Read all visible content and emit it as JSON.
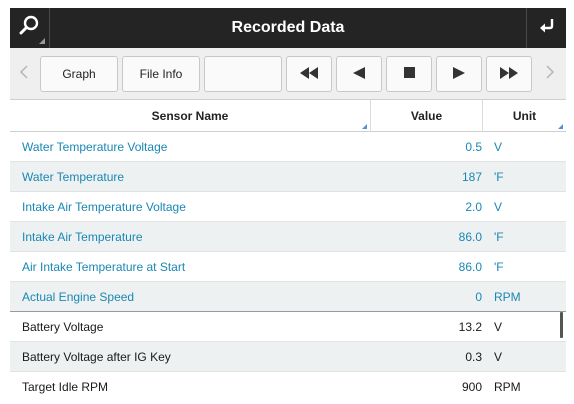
{
  "window": {
    "title": "Recorded Data"
  },
  "toolbar": {
    "graph_label": "Graph",
    "file_info_label": "File Info",
    "blank_label": ""
  },
  "table": {
    "headers": {
      "name": "Sensor Name",
      "value": "Value",
      "unit": "Unit"
    },
    "rows": [
      {
        "name": "Water Temperature Voltage",
        "value": "0.5",
        "unit": "V",
        "style": "blue"
      },
      {
        "name": "Water Temperature",
        "value": "187",
        "unit": "'F",
        "style": "blue"
      },
      {
        "name": "Intake Air Temperature Voltage",
        "value": "2.0",
        "unit": "V",
        "style": "blue"
      },
      {
        "name": "Intake Air Temperature",
        "value": "86.0",
        "unit": "'F",
        "style": "blue"
      },
      {
        "name": "Air Intake Temperature at Start",
        "value": "86.0",
        "unit": "'F",
        "style": "blue"
      },
      {
        "name": "Actual Engine Speed",
        "value": "0",
        "unit": "RPM",
        "style": "blue"
      },
      {
        "name": "Battery Voltage",
        "value": "13.2",
        "unit": "V",
        "style": "black"
      },
      {
        "name": "Battery Voltage after IG Key",
        "value": "0.3",
        "unit": "V",
        "style": "black"
      },
      {
        "name": "Target Idle RPM",
        "value": "900",
        "unit": "RPM",
        "style": "black"
      }
    ]
  },
  "colors": {
    "titlebar": "#242424",
    "accent_text": "#1a87b4",
    "alt_row": "#eef1f1",
    "sort_indicator": "#5a8fd6"
  },
  "icons": {
    "search": "search-icon",
    "back": "return-arrow-icon",
    "rewind": "rewind-icon",
    "prev": "play-reverse-icon",
    "stop": "stop-icon",
    "play": "play-icon",
    "fast_forward": "fast-forward-icon",
    "scroll_left": "chevron-left-icon",
    "scroll_right": "chevron-right-icon"
  }
}
